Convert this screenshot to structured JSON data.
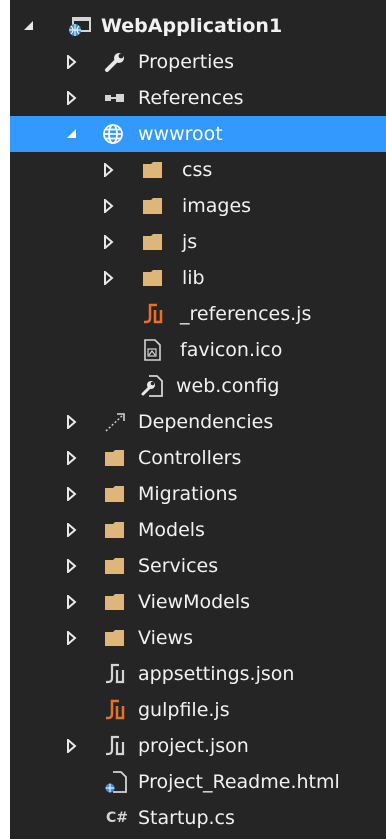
{
  "colors": {
    "background": "#252526",
    "selection": "#3399ff",
    "text": "#f1f1f1",
    "folder": "#dcb67a",
    "js_orange": "#e8702a",
    "icon_light": "#d4d4d4"
  },
  "tree": {
    "root": {
      "label": "WebApplication1",
      "icon": "web-project-icon",
      "expanded": true
    },
    "properties": {
      "label": "Properties",
      "icon": "wrench-icon"
    },
    "references": {
      "label": "References",
      "icon": "references-icon"
    },
    "wwwroot": {
      "label": "wwwroot",
      "icon": "globe-icon",
      "expanded": true,
      "selected": true,
      "children": {
        "css": {
          "label": "css",
          "icon": "folder-icon"
        },
        "images": {
          "label": "images",
          "icon": "folder-icon"
        },
        "js": {
          "label": "js",
          "icon": "folder-icon"
        },
        "lib": {
          "label": "lib",
          "icon": "folder-icon"
        },
        "references_js": {
          "label": "_references.js",
          "icon": "js-file-icon"
        },
        "favicon": {
          "label": "favicon.ico",
          "icon": "ico-file-icon"
        },
        "web_config": {
          "label": "web.config",
          "icon": "config-file-icon"
        }
      }
    },
    "dependencies": {
      "label": "Dependencies",
      "icon": "dependencies-icon"
    },
    "controllers": {
      "label": "Controllers",
      "icon": "folder-icon"
    },
    "migrations": {
      "label": "Migrations",
      "icon": "folder-icon"
    },
    "models": {
      "label": "Models",
      "icon": "folder-icon"
    },
    "services": {
      "label": "Services",
      "icon": "folder-icon"
    },
    "viewmodels": {
      "label": "ViewModels",
      "icon": "folder-icon"
    },
    "views": {
      "label": "Views",
      "icon": "folder-icon"
    },
    "appsettings": {
      "label": "appsettings.json",
      "icon": "json-file-icon"
    },
    "gulpfile": {
      "label": "gulpfile.js",
      "icon": "js-file-icon"
    },
    "project_json": {
      "label": "project.json",
      "icon": "json-file-icon"
    },
    "readme": {
      "label": "Project_Readme.html",
      "icon": "html-file-icon"
    },
    "startup": {
      "label": "Startup.cs",
      "icon": "csharp-file-icon",
      "icon_text": "C#"
    }
  }
}
